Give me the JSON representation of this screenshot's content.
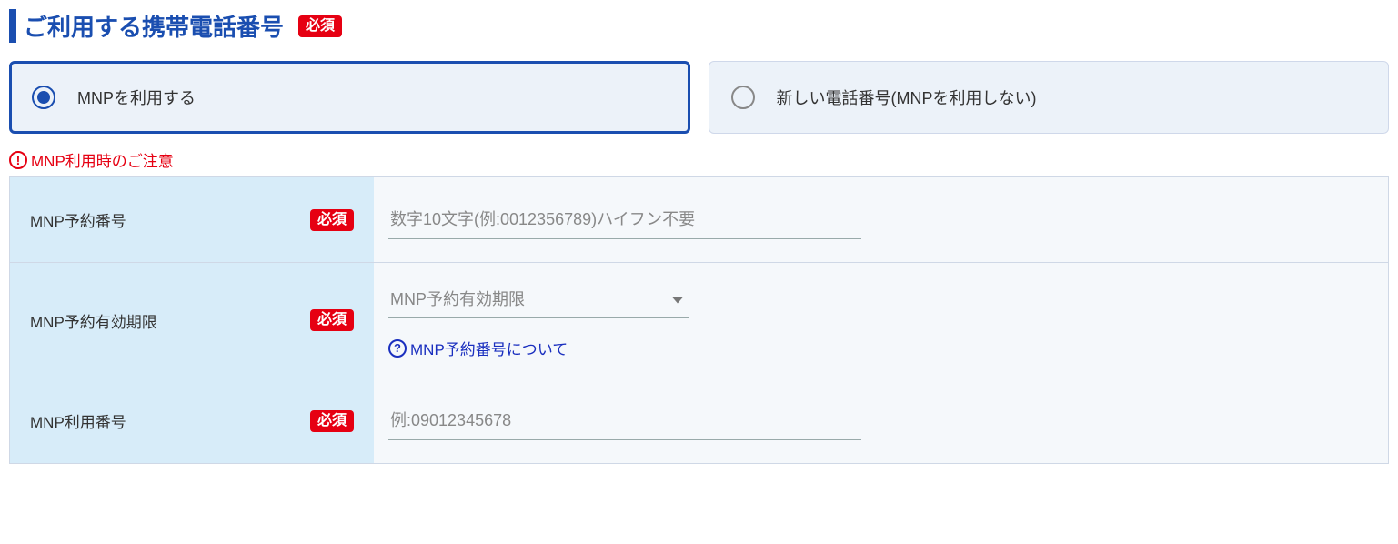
{
  "header": {
    "title": "ご利用する携帯電話番号",
    "required_badge": "必須"
  },
  "radio": {
    "option_mnp": "MNPを利用する",
    "option_new": "新しい電話番号(MNPを利用しない)"
  },
  "notice": {
    "text": "MNP利用時のご注意"
  },
  "rows": {
    "mnp_reserve": {
      "label": "MNP予約番号",
      "required": "必須",
      "placeholder": "数字10文字(例:0012356789)ハイフン不要"
    },
    "mnp_expiry": {
      "label": "MNP予約有効期限",
      "required": "必須",
      "select_placeholder": "MNP予約有効期限",
      "help_text": "MNP予約番号について"
    },
    "mnp_number": {
      "label": "MNP利用番号",
      "required": "必須",
      "placeholder": "例:09012345678"
    }
  }
}
